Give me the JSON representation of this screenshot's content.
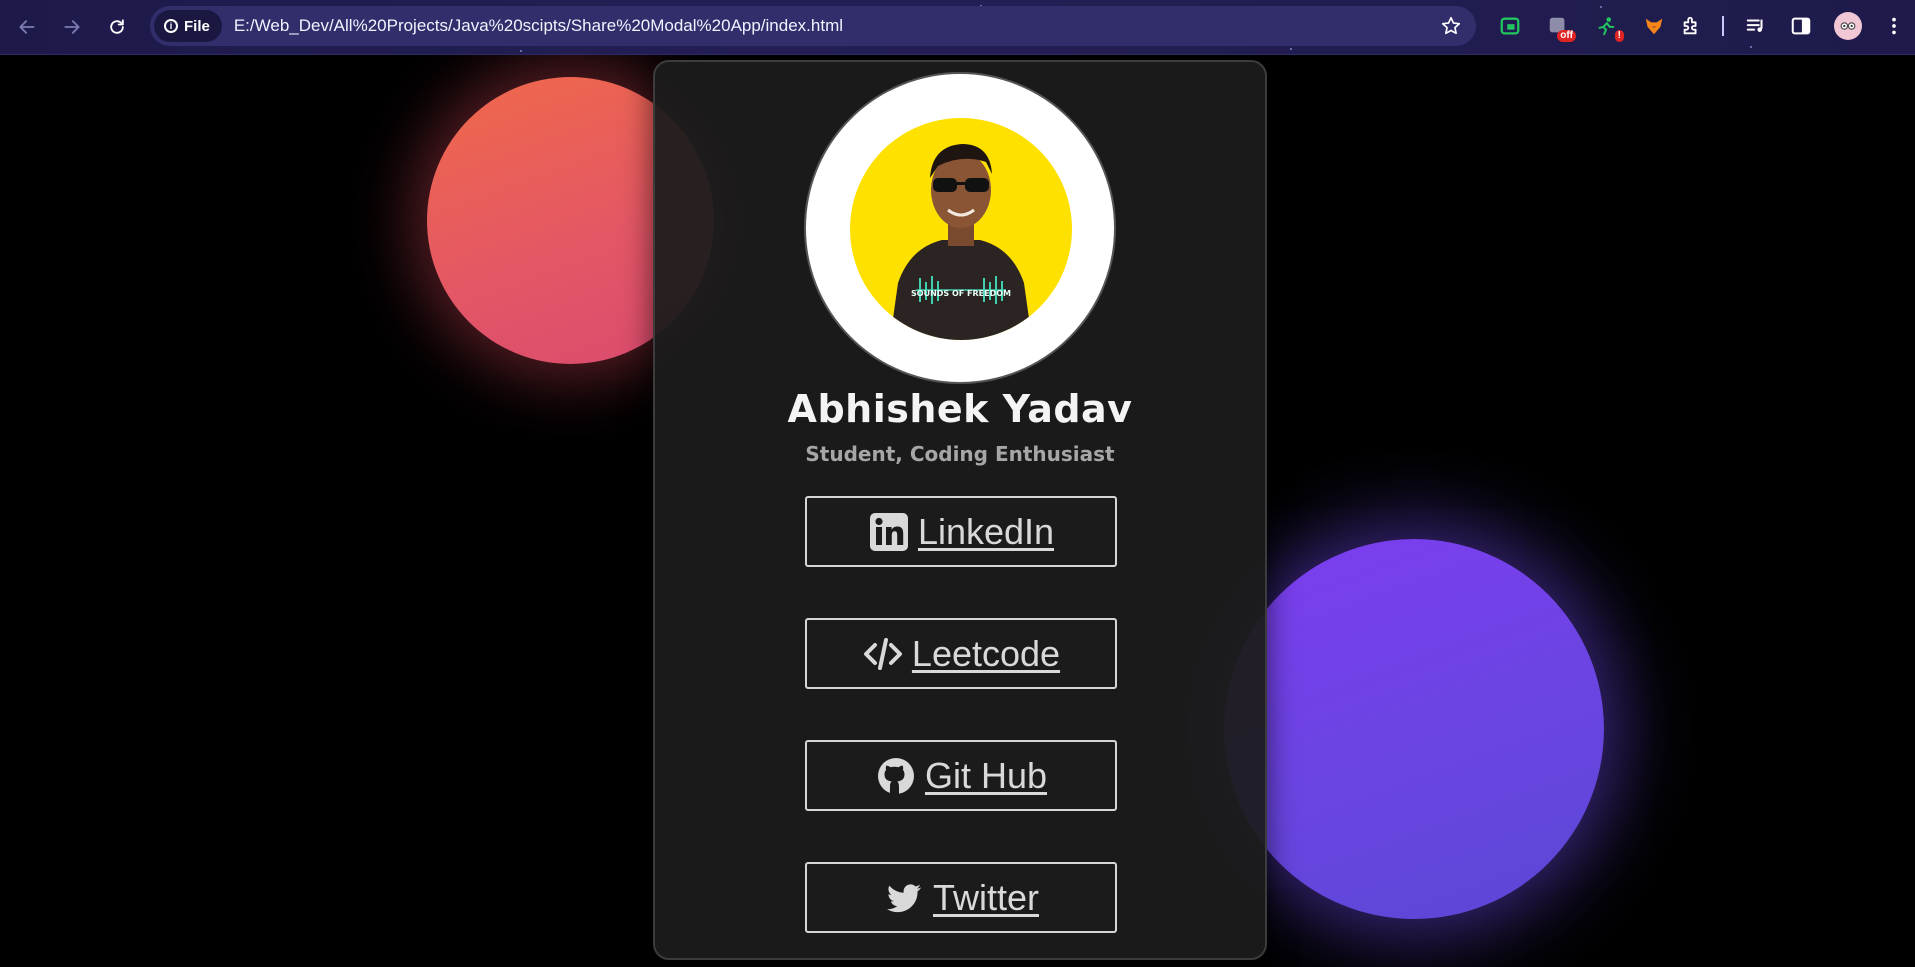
{
  "browser": {
    "site_chip_label": "File",
    "url": "E:/Web_Dev/All%20Projects/Java%20scipts/Share%20Modal%20App/index.html",
    "extensions": [
      {
        "name": "green-square-extension",
        "badge": ""
      },
      {
        "name": "off-extension",
        "badge": "off"
      },
      {
        "name": "alert-extension",
        "badge": "!"
      },
      {
        "name": "fox-extension",
        "badge": ""
      }
    ]
  },
  "profile": {
    "name": "Abhishek Yadav",
    "tagline": "Student, Coding Enthusiast",
    "shirt_text": "SOUNDS OF FREEDOM"
  },
  "links": [
    {
      "label": "LinkedIn",
      "icon": "linkedin-icon"
    },
    {
      "label": "Leetcode",
      "icon": "code-brackets-icon"
    },
    {
      "label": "Git Hub",
      "icon": "github-icon"
    },
    {
      "label": "Twitter",
      "icon": "twitter-icon"
    }
  ],
  "colors": {
    "page_bg": "#000000",
    "card_bg": "#1c1c1c",
    "blob_red": "#e85a5e",
    "blob_purple": "#6f45e6",
    "avatar_bg": "#ffe100",
    "button_border": "#d6d6d6",
    "button_text": "#d9d9d9"
  }
}
